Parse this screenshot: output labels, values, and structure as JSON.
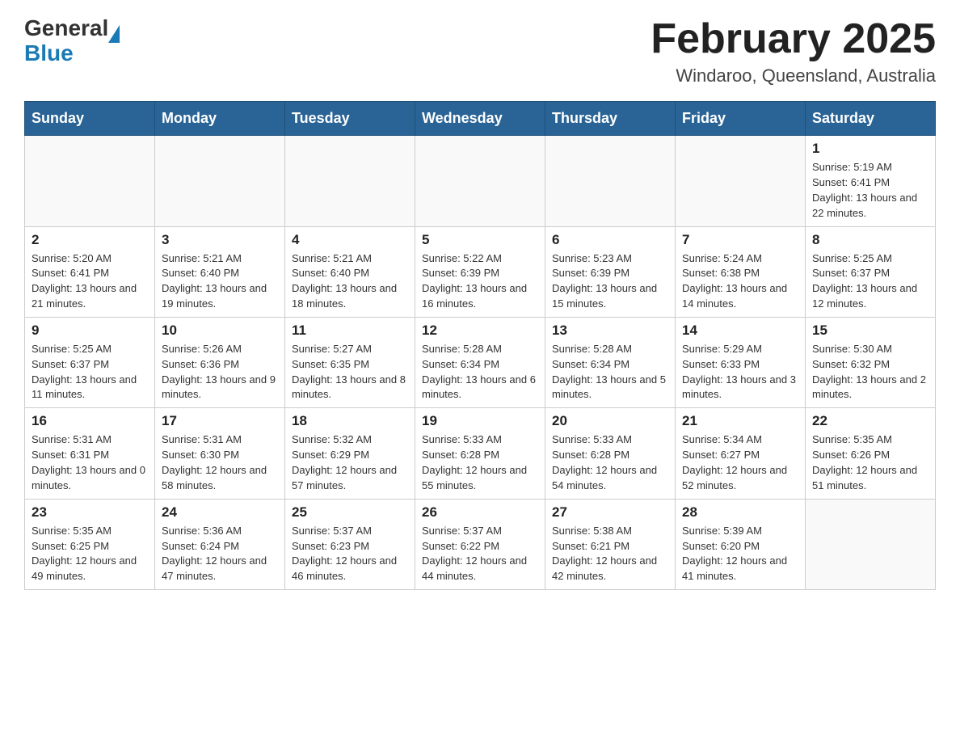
{
  "header": {
    "logo_general": "General",
    "logo_blue": "Blue",
    "title": "February 2025",
    "subtitle": "Windaroo, Queensland, Australia"
  },
  "weekdays": [
    "Sunday",
    "Monday",
    "Tuesday",
    "Wednesday",
    "Thursday",
    "Friday",
    "Saturday"
  ],
  "weeks": [
    [
      {
        "day": "",
        "sunrise": "",
        "sunset": "",
        "daylight": ""
      },
      {
        "day": "",
        "sunrise": "",
        "sunset": "",
        "daylight": ""
      },
      {
        "day": "",
        "sunrise": "",
        "sunset": "",
        "daylight": ""
      },
      {
        "day": "",
        "sunrise": "",
        "sunset": "",
        "daylight": ""
      },
      {
        "day": "",
        "sunrise": "",
        "sunset": "",
        "daylight": ""
      },
      {
        "day": "",
        "sunrise": "",
        "sunset": "",
        "daylight": ""
      },
      {
        "day": "1",
        "sunrise": "Sunrise: 5:19 AM",
        "sunset": "Sunset: 6:41 PM",
        "daylight": "Daylight: 13 hours and 22 minutes."
      }
    ],
    [
      {
        "day": "2",
        "sunrise": "Sunrise: 5:20 AM",
        "sunset": "Sunset: 6:41 PM",
        "daylight": "Daylight: 13 hours and 21 minutes."
      },
      {
        "day": "3",
        "sunrise": "Sunrise: 5:21 AM",
        "sunset": "Sunset: 6:40 PM",
        "daylight": "Daylight: 13 hours and 19 minutes."
      },
      {
        "day": "4",
        "sunrise": "Sunrise: 5:21 AM",
        "sunset": "Sunset: 6:40 PM",
        "daylight": "Daylight: 13 hours and 18 minutes."
      },
      {
        "day": "5",
        "sunrise": "Sunrise: 5:22 AM",
        "sunset": "Sunset: 6:39 PM",
        "daylight": "Daylight: 13 hours and 16 minutes."
      },
      {
        "day": "6",
        "sunrise": "Sunrise: 5:23 AM",
        "sunset": "Sunset: 6:39 PM",
        "daylight": "Daylight: 13 hours and 15 minutes."
      },
      {
        "day": "7",
        "sunrise": "Sunrise: 5:24 AM",
        "sunset": "Sunset: 6:38 PM",
        "daylight": "Daylight: 13 hours and 14 minutes."
      },
      {
        "day": "8",
        "sunrise": "Sunrise: 5:25 AM",
        "sunset": "Sunset: 6:37 PM",
        "daylight": "Daylight: 13 hours and 12 minutes."
      }
    ],
    [
      {
        "day": "9",
        "sunrise": "Sunrise: 5:25 AM",
        "sunset": "Sunset: 6:37 PM",
        "daylight": "Daylight: 13 hours and 11 minutes."
      },
      {
        "day": "10",
        "sunrise": "Sunrise: 5:26 AM",
        "sunset": "Sunset: 6:36 PM",
        "daylight": "Daylight: 13 hours and 9 minutes."
      },
      {
        "day": "11",
        "sunrise": "Sunrise: 5:27 AM",
        "sunset": "Sunset: 6:35 PM",
        "daylight": "Daylight: 13 hours and 8 minutes."
      },
      {
        "day": "12",
        "sunrise": "Sunrise: 5:28 AM",
        "sunset": "Sunset: 6:34 PM",
        "daylight": "Daylight: 13 hours and 6 minutes."
      },
      {
        "day": "13",
        "sunrise": "Sunrise: 5:28 AM",
        "sunset": "Sunset: 6:34 PM",
        "daylight": "Daylight: 13 hours and 5 minutes."
      },
      {
        "day": "14",
        "sunrise": "Sunrise: 5:29 AM",
        "sunset": "Sunset: 6:33 PM",
        "daylight": "Daylight: 13 hours and 3 minutes."
      },
      {
        "day": "15",
        "sunrise": "Sunrise: 5:30 AM",
        "sunset": "Sunset: 6:32 PM",
        "daylight": "Daylight: 13 hours and 2 minutes."
      }
    ],
    [
      {
        "day": "16",
        "sunrise": "Sunrise: 5:31 AM",
        "sunset": "Sunset: 6:31 PM",
        "daylight": "Daylight: 13 hours and 0 minutes."
      },
      {
        "day": "17",
        "sunrise": "Sunrise: 5:31 AM",
        "sunset": "Sunset: 6:30 PM",
        "daylight": "Daylight: 12 hours and 58 minutes."
      },
      {
        "day": "18",
        "sunrise": "Sunrise: 5:32 AM",
        "sunset": "Sunset: 6:29 PM",
        "daylight": "Daylight: 12 hours and 57 minutes."
      },
      {
        "day": "19",
        "sunrise": "Sunrise: 5:33 AM",
        "sunset": "Sunset: 6:28 PM",
        "daylight": "Daylight: 12 hours and 55 minutes."
      },
      {
        "day": "20",
        "sunrise": "Sunrise: 5:33 AM",
        "sunset": "Sunset: 6:28 PM",
        "daylight": "Daylight: 12 hours and 54 minutes."
      },
      {
        "day": "21",
        "sunrise": "Sunrise: 5:34 AM",
        "sunset": "Sunset: 6:27 PM",
        "daylight": "Daylight: 12 hours and 52 minutes."
      },
      {
        "day": "22",
        "sunrise": "Sunrise: 5:35 AM",
        "sunset": "Sunset: 6:26 PM",
        "daylight": "Daylight: 12 hours and 51 minutes."
      }
    ],
    [
      {
        "day": "23",
        "sunrise": "Sunrise: 5:35 AM",
        "sunset": "Sunset: 6:25 PM",
        "daylight": "Daylight: 12 hours and 49 minutes."
      },
      {
        "day": "24",
        "sunrise": "Sunrise: 5:36 AM",
        "sunset": "Sunset: 6:24 PM",
        "daylight": "Daylight: 12 hours and 47 minutes."
      },
      {
        "day": "25",
        "sunrise": "Sunrise: 5:37 AM",
        "sunset": "Sunset: 6:23 PM",
        "daylight": "Daylight: 12 hours and 46 minutes."
      },
      {
        "day": "26",
        "sunrise": "Sunrise: 5:37 AM",
        "sunset": "Sunset: 6:22 PM",
        "daylight": "Daylight: 12 hours and 44 minutes."
      },
      {
        "day": "27",
        "sunrise": "Sunrise: 5:38 AM",
        "sunset": "Sunset: 6:21 PM",
        "daylight": "Daylight: 12 hours and 42 minutes."
      },
      {
        "day": "28",
        "sunrise": "Sunrise: 5:39 AM",
        "sunset": "Sunset: 6:20 PM",
        "daylight": "Daylight: 12 hours and 41 minutes."
      },
      {
        "day": "",
        "sunrise": "",
        "sunset": "",
        "daylight": ""
      }
    ]
  ]
}
